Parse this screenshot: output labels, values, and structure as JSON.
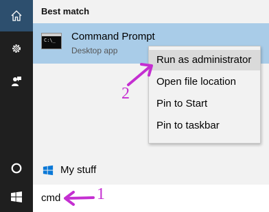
{
  "rail": {
    "icons": [
      "home-icon",
      "gear-icon",
      "feedback-icon",
      "cortana-circle-icon",
      "windows-logo-icon"
    ],
    "home_bg": "#2d4f6e",
    "bg": "#1f1f1f"
  },
  "results": {
    "section_title": "Best match",
    "best_match": {
      "title": "Command Prompt",
      "subtitle": "Desktop app",
      "icon_text": "C:\\_",
      "bg": "#a9cce8"
    }
  },
  "context_menu": {
    "items": [
      {
        "label": "Run as administrator",
        "highlighted": true
      },
      {
        "label": "Open file location",
        "highlighted": false
      },
      {
        "label": "Pin to Start",
        "highlighted": false
      },
      {
        "label": "Pin to taskbar",
        "highlighted": false
      }
    ]
  },
  "annotations": {
    "step_2": "2",
    "step_1": "1",
    "color": "#c42fd1"
  },
  "my_stuff": {
    "label": "My stuff"
  },
  "search": {
    "value": "cmd"
  }
}
